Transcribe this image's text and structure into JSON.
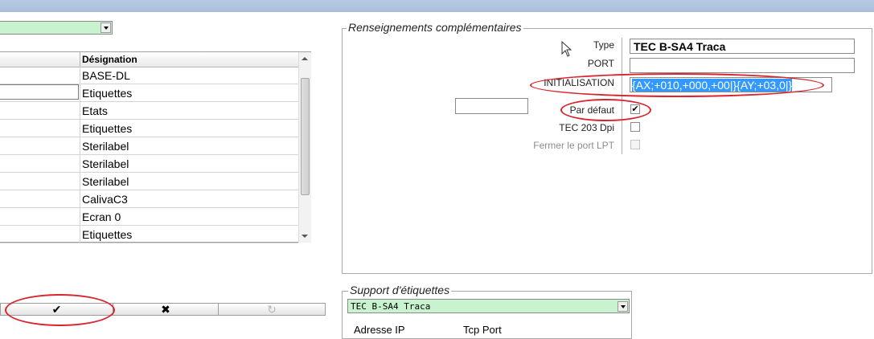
{
  "left_panel": {
    "grid": {
      "header": {
        "designation": "Désignation"
      },
      "rows": [
        {
          "designation": "BASE-DL"
        },
        {
          "designation": "Etiquettes"
        },
        {
          "designation": "Etats"
        },
        {
          "designation": "Etiquettes"
        },
        {
          "designation": "Sterilabel"
        },
        {
          "designation": "Sterilabel"
        },
        {
          "designation": "Sterilabel"
        },
        {
          "designation": "CalivaC3"
        },
        {
          "designation": "Ecran 0"
        },
        {
          "designation": "Etiquettes"
        }
      ]
    },
    "buttons": {
      "ok_icon": "✔",
      "cancel_icon": "✖",
      "undo_icon": "↻"
    }
  },
  "renseignements": {
    "legend": "Renseignements complémentaires",
    "type_label": "Type",
    "type_value": "TEC B-SA4 Traca",
    "port_label": "PORT",
    "port_value": "",
    "init_label": "INITIALISATION",
    "init_value": "{AX;+010,+000,+00|}{AY;+03,0|}",
    "par_defaut_label": "Par défaut",
    "par_defaut_checked": "✔",
    "tec203_label": "TEC 203 Dpi",
    "fermer_label": "Fermer le port LPT"
  },
  "support": {
    "legend": "Support d'étiquettes",
    "selected": "TEC B-SA4 Traca",
    "adresse_ip_label": "Adresse IP",
    "tcp_port_label": "Tcp Port"
  },
  "colors": {
    "combo_bg": "#c9f3cf",
    "highlight": "#3399ff",
    "annotation": "#d8242c"
  }
}
